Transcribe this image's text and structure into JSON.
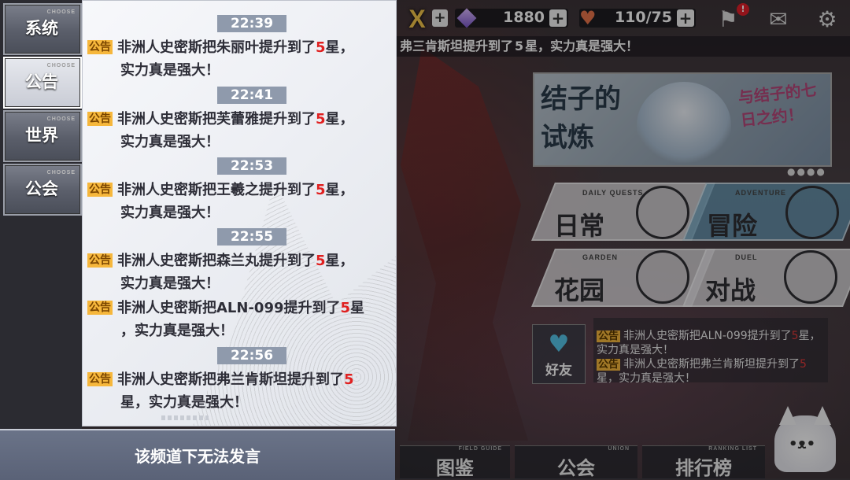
{
  "sidebar": {
    "tabs": [
      {
        "label": "系统",
        "sub": "CHOOSE",
        "active": false
      },
      {
        "label": "公告",
        "sub": "CHOOSE",
        "active": true
      },
      {
        "label": "世界",
        "sub": "CHOOSE",
        "active": false
      },
      {
        "label": "公会",
        "sub": "CHOOSE",
        "active": false
      }
    ]
  },
  "chat": {
    "tag": "公告",
    "messages": [
      {
        "time": "22:39",
        "line1_pre": "非洲人史密斯把朱丽叶提升到了",
        "num": "5",
        "line1_post": "星，",
        "line2": "实力真是强大！"
      },
      {
        "time": "22:41",
        "line1_pre": "非洲人史密斯把芙蕾雅提升到了",
        "num": "5",
        "line1_post": "星，",
        "line2": "实力真是强大！"
      },
      {
        "time": "22:53",
        "line1_pre": "非洲人史密斯把王羲之提升到了",
        "num": "5",
        "line1_post": "星，",
        "line2": "实力真是强大！"
      },
      {
        "time": "22:55",
        "line1_pre": "非洲人史密斯把森兰丸提升到了",
        "num": "5",
        "line1_post": "星，",
        "line2": "实力真是强大！"
      },
      {
        "time": "",
        "line1_pre": "非洲人史密斯把ALN-099提升到了",
        "num": "5",
        "line1_post": "星",
        "line2": "，实力真是强大！"
      },
      {
        "time": "22:56",
        "line1_pre": "非洲人史密斯把弗兰肯斯坦提升到了",
        "num": "5",
        "line1_post": "",
        "line2": "星，实力真是强大！"
      }
    ],
    "footer": "该频道下无法发言"
  },
  "topbar": {
    "close_glyph": "X",
    "crystals": "1880",
    "stamina": "110/75",
    "notification_count": "!",
    "ticker_pre": "弗三肯斯坦提升到了",
    "ticker_num": "5",
    "ticker_post": "星，实力真是强大！"
  },
  "banner": {
    "title_main": "结子的",
    "title_sub": "试炼",
    "tagline": "与结子的七日之约！"
  },
  "menu": {
    "daily": {
      "label": "日常",
      "sub": "DAILY QUESTS"
    },
    "adventure": {
      "label": "冒险",
      "sub": "ADVENTURE"
    },
    "garden": {
      "label": "花园",
      "sub": "GARDEN"
    },
    "duel": {
      "label": "对战",
      "sub": "DUEL"
    }
  },
  "friend": {
    "label": "好友"
  },
  "mini_notices": [
    {
      "tag": "公告",
      "pre": "非洲人史密斯把ALN-099提升到了",
      "num": "5",
      "post": "星，",
      "line2": "实力真是强大！"
    },
    {
      "tag": "公告",
      "pre": "非洲人史密斯把弗兰肯斯坦提升到了",
      "num": "5",
      "post": "",
      "line2": "星，实力真是强大！"
    }
  ],
  "bottom_nav": [
    {
      "label": "图鉴",
      "sub": "FIELD GUIDE"
    },
    {
      "label": "公会",
      "sub": "UNION"
    },
    {
      "label": "排行榜",
      "sub": "RANKING LIST"
    }
  ],
  "colors": {
    "accent_gold": "#f3c54b",
    "tag_bg": "#f6b73c",
    "star_red": "#e02020"
  }
}
